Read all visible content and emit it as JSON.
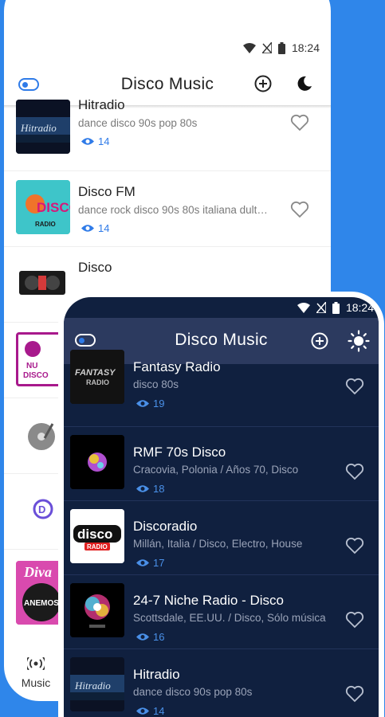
{
  "light_app": {
    "status_time": "18:24",
    "title": "Disco Music",
    "stations": [
      {
        "name": "Hitradio",
        "genre": "dance disco 90s pop 80s",
        "views": "14"
      },
      {
        "name": "Disco FM",
        "genre": "dance rock disco 90s 80s italiana dult…",
        "views": "14"
      },
      {
        "name": "Disco",
        "genre": "",
        "views": ""
      }
    ],
    "thumb_labels": {
      "disco_fm": "DISCO",
      "disco_fm_sub": "RADIO",
      "nu_disco_line1": "NU",
      "nu_disco_line2": "DISCO",
      "diva": "Diva",
      "anemos": "ANEMOS"
    },
    "nav_label": "Music"
  },
  "dark_app": {
    "status_time": "18:24",
    "title": "Disco Music",
    "stations": [
      {
        "name": "Fantasy Radio",
        "genre": "disco 80s",
        "views": "19"
      },
      {
        "name": "RMF 70s Disco",
        "genre": "Cracovia, Polonia / Años 70, Disco",
        "views": "18"
      },
      {
        "name": "Discoradio",
        "genre": "Millán, Italia / Disco, Electro, House",
        "views": "17"
      },
      {
        "name": "24-7 Niche Radio - Disco",
        "genre": "Scottsdale, EE.UU. / Disco, Sólo música",
        "views": "16"
      },
      {
        "name": "Hitradio",
        "genre": "dance disco 90s pop 80s",
        "views": "14"
      }
    ],
    "thumb_labels": {
      "fantasy": "FANTASY",
      "fantasy_sub": "RADIO",
      "discoradio": "disco",
      "discoradio_sub": "RADIO",
      "hitradio": "Hitradio"
    }
  },
  "colors": {
    "background": "#2f86ea",
    "accent": "#2f7be8",
    "dark_bg": "#10203f",
    "dark_appbar": "#2c3a5f"
  },
  "icons": [
    "toggle-icon",
    "add-circle-icon",
    "moon-icon",
    "sun-icon",
    "heart-icon",
    "eye-icon",
    "wifi-icon",
    "signal-icon",
    "battery-icon",
    "radio-waves-icon"
  ]
}
